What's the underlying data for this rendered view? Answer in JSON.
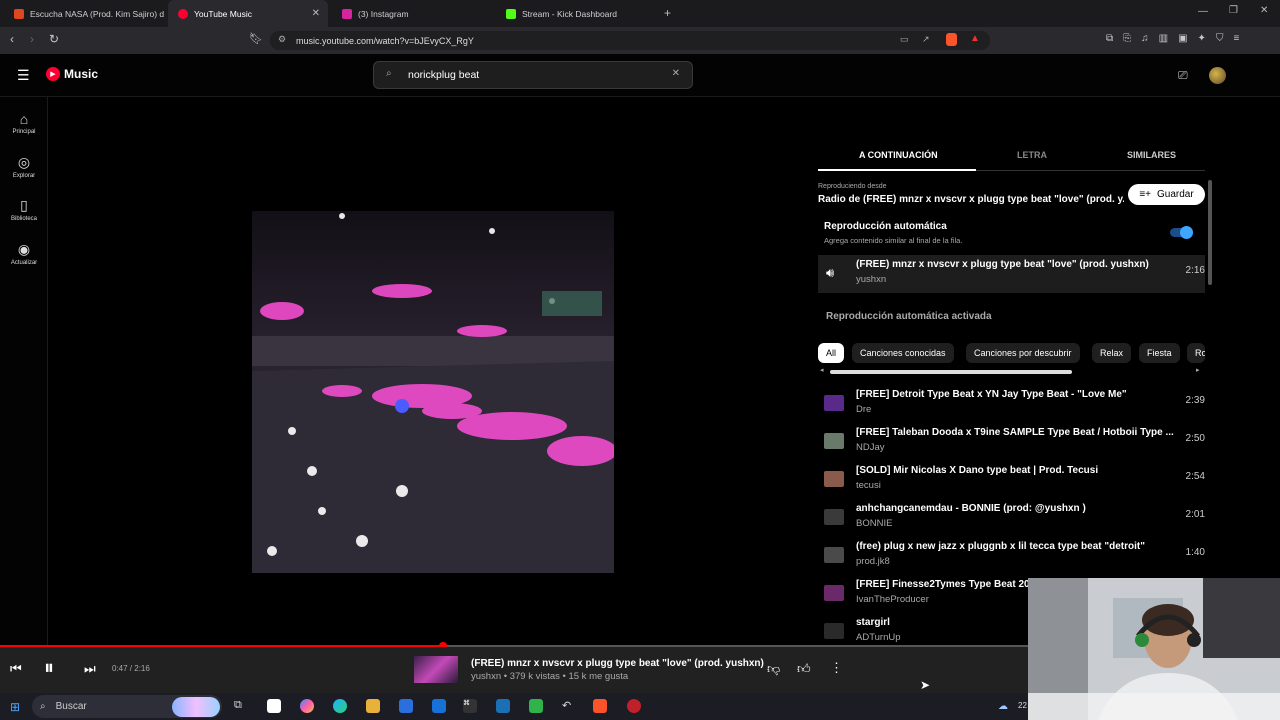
{
  "browser": {
    "tabs": [
      {
        "label": "Escucha NASA (Prod. Kim Sajiro) de",
        "icon_color": "#e0461f"
      },
      {
        "label": "YouTube Music",
        "icon_color": "#ff0033"
      },
      {
        "label": "(3) Instagram",
        "icon_color": "#d6249f"
      },
      {
        "label": "Stream - Kick Dashboard",
        "icon_color": "#53fc18"
      }
    ],
    "url": "music.youtube.com/watch?v=bJEvyCX_RgY"
  },
  "app": {
    "logo_text": "Music",
    "search_value": "norickplug beat"
  },
  "sidebar": {
    "items": [
      {
        "label": "Principal",
        "icon": "home-icon"
      },
      {
        "label": "Explorar",
        "icon": "explore-icon"
      },
      {
        "label": "Biblioteca",
        "icon": "library-icon"
      },
      {
        "label": "Actualizar",
        "icon": "upgrade-icon"
      }
    ]
  },
  "panel": {
    "tabs": [
      "A CONTINUACIÓN",
      "LETRA",
      "SIMILARES"
    ],
    "playing_from_label": "Reproduciendo desde",
    "playing_from_title": "Radio de (FREE) mnzr x nvscvr x plugg type beat \"love\" (prod. y...",
    "save_label": "Guardar",
    "autoplay_title": "Reproducción automática",
    "autoplay_desc": "Agrega contenido similar al final de la fila.",
    "autoplay_on": true,
    "current": {
      "title": "(FREE) mnzr x nvscvr x plugg type beat \"love\" (prod. yushxn)",
      "artist": "yushxn",
      "duration": "2:16"
    },
    "autoplay_active": "Reproducción automática activada",
    "chips": [
      "All",
      "Canciones conocidas",
      "Canciones por descubrir",
      "Relax",
      "Fiesta",
      "Ro"
    ],
    "queue": [
      {
        "title": "[FREE] Detroit Type Beat x YN Jay Type Beat - \"Love Me\"",
        "artist": "Dre",
        "duration": "2:39",
        "thumb": "#5a2a8a"
      },
      {
        "title": "[FREE] Taleban Dooda x T9ine SAMPLE Type Beat / Hotboii Type ...",
        "artist": "NDJay",
        "duration": "2:50",
        "thumb": "#6a7a6a"
      },
      {
        "title": "[SOLD] Mir Nicolas X Dano type beat | Prod. Tecusi",
        "artist": "tecusi",
        "duration": "2:54",
        "thumb": "#8a5a4a"
      },
      {
        "title": "anhchangcanemdau - BONNIE (prod: @yushxn )",
        "artist": "BONNIE",
        "duration": "2:01",
        "thumb": "#3a3a3a"
      },
      {
        "title": "(free) plug x new jazz x pluggnb x lil tecca type beat \"detroit\"",
        "artist": "prod.jk8",
        "duration": "1:40",
        "thumb": "#4a4a4a"
      },
      {
        "title": "[FREE] Finesse2Tymes Type Beat 20",
        "artist": "IvanTheProducer",
        "duration": "",
        "thumb": "#6a2a6a"
      },
      {
        "title": "stargirl",
        "artist": "ADTurnUp",
        "duration": "",
        "thumb": "#2a2a2a"
      }
    ]
  },
  "player": {
    "time": "0:47 / 2:16",
    "progress": 0.346,
    "title": "(FREE) mnzr x nvscvr x plugg type beat \"love\" (prod. yushxn)",
    "subtitle": "yushxn • 379 k vistas • 15 k me gusta"
  },
  "taskbar": {
    "search_label": "Buscar",
    "clock": "22"
  }
}
